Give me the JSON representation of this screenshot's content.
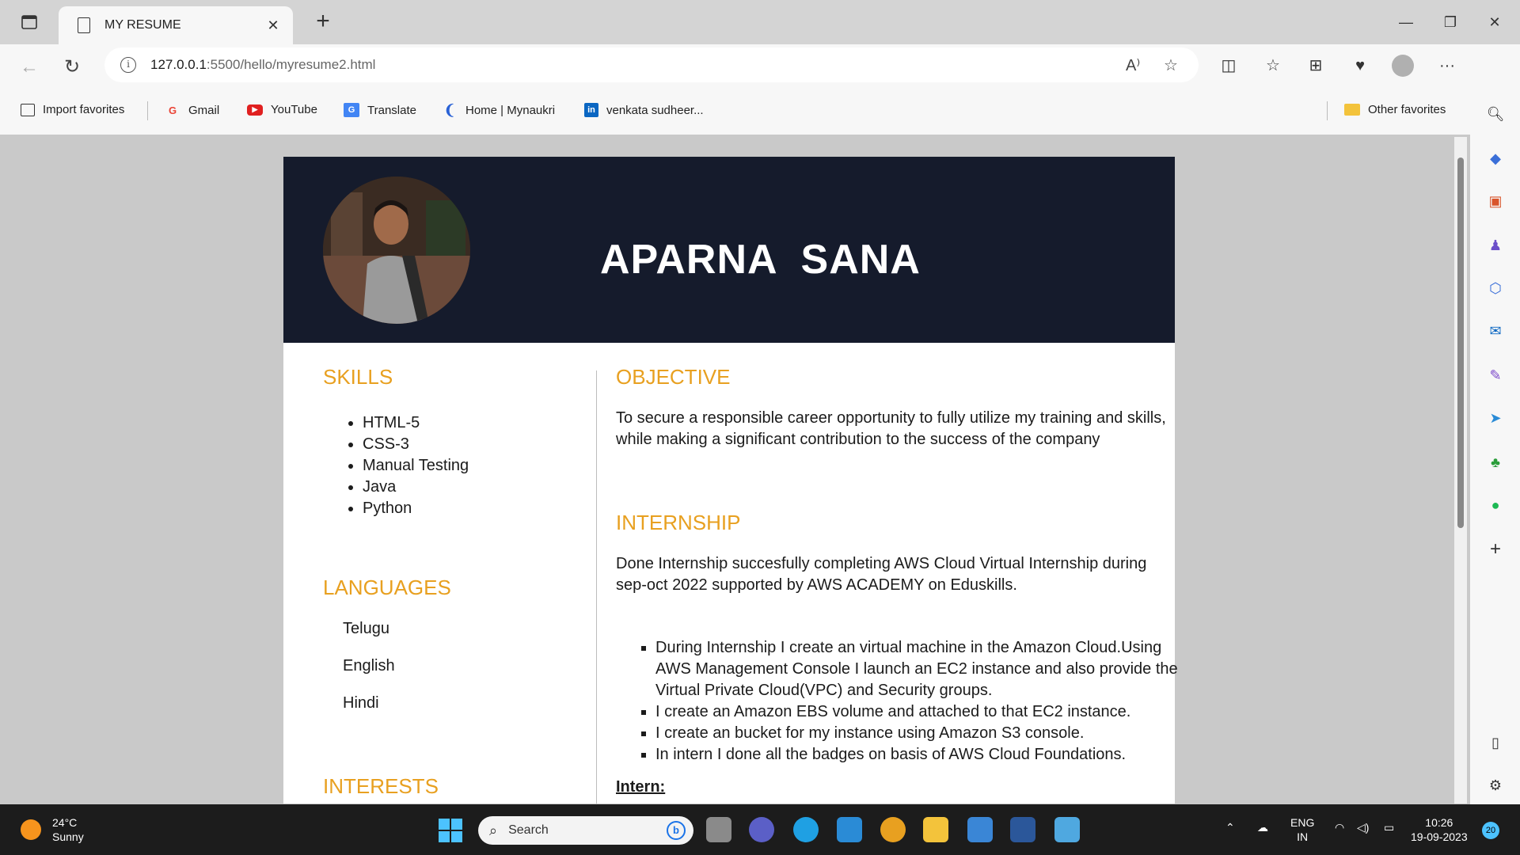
{
  "browser": {
    "tab_title": "MY RESUME",
    "url_host": "127.0.0.1",
    "url_path": ":5500/hello/myresume2.html"
  },
  "favorites": {
    "items": [
      {
        "label": "Import favorites",
        "icon": "import-icon"
      },
      {
        "label": "Gmail",
        "icon": "google-icon"
      },
      {
        "label": "YouTube",
        "icon": "youtube-icon"
      },
      {
        "label": "Translate",
        "icon": "translate-icon"
      },
      {
        "label": "Home | Mynaukri",
        "icon": "naukri-icon"
      },
      {
        "label": "venkata sudheer...",
        "icon": "linkedin-icon"
      }
    ],
    "other": "Other favorites"
  },
  "resume": {
    "name": "APARNA  SANA",
    "skills_title": "SKILLS",
    "skills": [
      "HTML-5",
      "CSS-3",
      "Manual Testing",
      "Java",
      "Python"
    ],
    "languages_title": "LANGUAGES",
    "languages": [
      "Telugu",
      "English",
      "Hindi"
    ],
    "interests_title": "INTERESTS",
    "objective_title": "OBJECTIVE",
    "objective_text": "To secure a responsible career opportunity to fully utilize my training and skills, while making a significant contribution to the success of the company",
    "internship_title": "INTERNSHIP",
    "internship_text": "Done Internship succesfully completing AWS Cloud Virtual Internship during sep-oct 2022 supported by AWS ACADEMY on Eduskills.",
    "intern_label": "Intern:",
    "intern_points": [
      "During Internship I create an virtual machine in the Amazon Cloud.Using AWS Management Console I launch an EC2 instance and also provide the Virtual Private Cloud(VPC) and Security groups.",
      "I create an Amazon EBS volume and attached to that EC2 instance.",
      "I create an bucket for my instance using Amazon S3 console.",
      "In intern I done all the badges on basis of AWS Cloud Foundations."
    ]
  },
  "taskbar": {
    "temp": "24°C",
    "condition": "Sunny",
    "search_placeholder": "Search",
    "lang_line1": "ENG",
    "lang_line2": "IN",
    "time": "10:26",
    "date": "19-09-2023",
    "notif_count": "20"
  },
  "colors": {
    "header_bg": "#151b2c",
    "accent": "#e8a020"
  }
}
